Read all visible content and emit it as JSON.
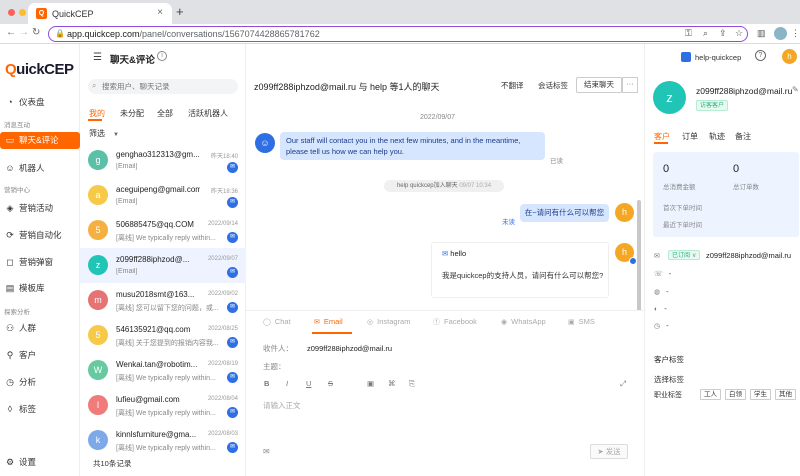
{
  "browser": {
    "tab_title": "QuickCEP",
    "url_host": "app.quickcep.com",
    "url_path": "/panel/conversations/1567074428865781762"
  },
  "sidebar": {
    "logo_q": "Q",
    "logo_rest": "uickCEP",
    "items": [
      {
        "label": "仪表盘"
      },
      {
        "label": "聊天&评论"
      },
      {
        "label": "机器人"
      },
      {
        "label": "营销活动"
      },
      {
        "label": "营销自动化"
      },
      {
        "label": "营销弹窗"
      },
      {
        "label": "模板库"
      },
      {
        "label": "人群"
      },
      {
        "label": "客户"
      },
      {
        "label": "分析"
      },
      {
        "label": "标签"
      },
      {
        "label": "设置"
      }
    ],
    "groups": [
      "消息互动",
      "营销中心",
      "探索分析"
    ]
  },
  "conversations": {
    "title": "聊天&评论",
    "search_placeholder": "搜索用户、聊天记录",
    "tabs": [
      "我的",
      "未分配",
      "全部",
      "活跃机器人"
    ],
    "filter": "筛选",
    "items": [
      {
        "initial": "g",
        "name": "genghao312313@gm...",
        "time": "昨天18:40",
        "preview": "[Email]"
      },
      {
        "initial": "a",
        "name": "aceguipeng@gmail.com",
        "time": "昨天18:36",
        "preview": "[Email]"
      },
      {
        "initial": "5",
        "name": "506885475@qq.COM",
        "time": "2022/09/14",
        "preview": "[离线] We typically reply within..."
      },
      {
        "initial": "z",
        "name": "z099ff288iphzod@...",
        "time": "2022/09/07",
        "preview": "[Email]"
      },
      {
        "initial": "m",
        "name": "musu2018smt@163...",
        "time": "2022/09/02",
        "preview": "[离线] 您可以留下您的问题，或..."
      },
      {
        "initial": "5",
        "name": "546135921@qq.com",
        "time": "2022/08/25",
        "preview": "[离线] 关于您提到的报销内容我..."
      },
      {
        "initial": "W",
        "name": "Wenkai.tan@robotim...",
        "time": "2022/08/19",
        "preview": "[离线] We typically reply within..."
      },
      {
        "initial": "l",
        "name": "lufieu@gmail.com",
        "time": "2022/08/04",
        "preview": "[离线] We typically reply within..."
      },
      {
        "initial": "k",
        "name": "kinnlsfurniture@gma...",
        "time": "2022/08/03",
        "preview": "[离线] We typically reply within..."
      }
    ],
    "count": "共10条记录"
  },
  "chat": {
    "title": "z099ff288iphzod@mail.ru 与 help 等1人的聊天",
    "translate": "不翻译",
    "tag": "会话标签",
    "end_button": "结束聊天",
    "more": "···",
    "date": "2022/09/07",
    "bot_initial": "☺",
    "bot_message": "Our staff will contact you in the next few minutes, and in the meantime, please tell us how we can help you.",
    "read": "已读",
    "system_text": "help quickcep加入聊天",
    "system_time": "09/07 10:34",
    "user_initial": "h",
    "user_message": "在~请问有什么可以帮您",
    "unread": "未读",
    "email_subject": "hello",
    "email_body": "我是quickcep的支持人员，请问有什么可以帮您?"
  },
  "compose": {
    "channels": [
      "Chat",
      "Email",
      "Instagram",
      "Facebook",
      "WhatsApp",
      "SMS"
    ],
    "to_label": "收件人：",
    "to_value": "z099ff288iphzod@mail.ru",
    "subject_label": "主题：",
    "body_placeholder": "请输入正文",
    "send": "发送",
    "tools": [
      "B",
      "I",
      "U",
      "S",
      "▣",
      "⌘",
      "⎘",
      "⤢"
    ]
  },
  "right_panel": {
    "agent_name": "help-quickcep",
    "agent_initial": "h",
    "customer_initial": "z",
    "customer_name": "z099ff288iphzod@mail.ru",
    "customer_badge": "访客客户",
    "tabs": [
      "客户",
      "订单",
      "轨迹",
      "备注"
    ],
    "stats": [
      {
        "value": "0",
        "label": "总消费金额"
      },
      {
        "value": "0",
        "label": "总订单数"
      }
    ],
    "first_order": "首次下单时间",
    "last_order": "最近下单时间",
    "stage": "已订阅",
    "stage_email": "z099ff288iphzod@mail.ru",
    "properties": [
      "-",
      "-",
      "-",
      "-"
    ],
    "tag_section": "客户标签",
    "tag_select": "选择标签",
    "job_label": "职业标签",
    "job_tags": [
      "工人",
      "白领",
      "学生",
      "其他"
    ]
  },
  "colors": {
    "accent": "#ff6600",
    "blue": "#2f6fe4",
    "teal": "#20c5b5"
  }
}
